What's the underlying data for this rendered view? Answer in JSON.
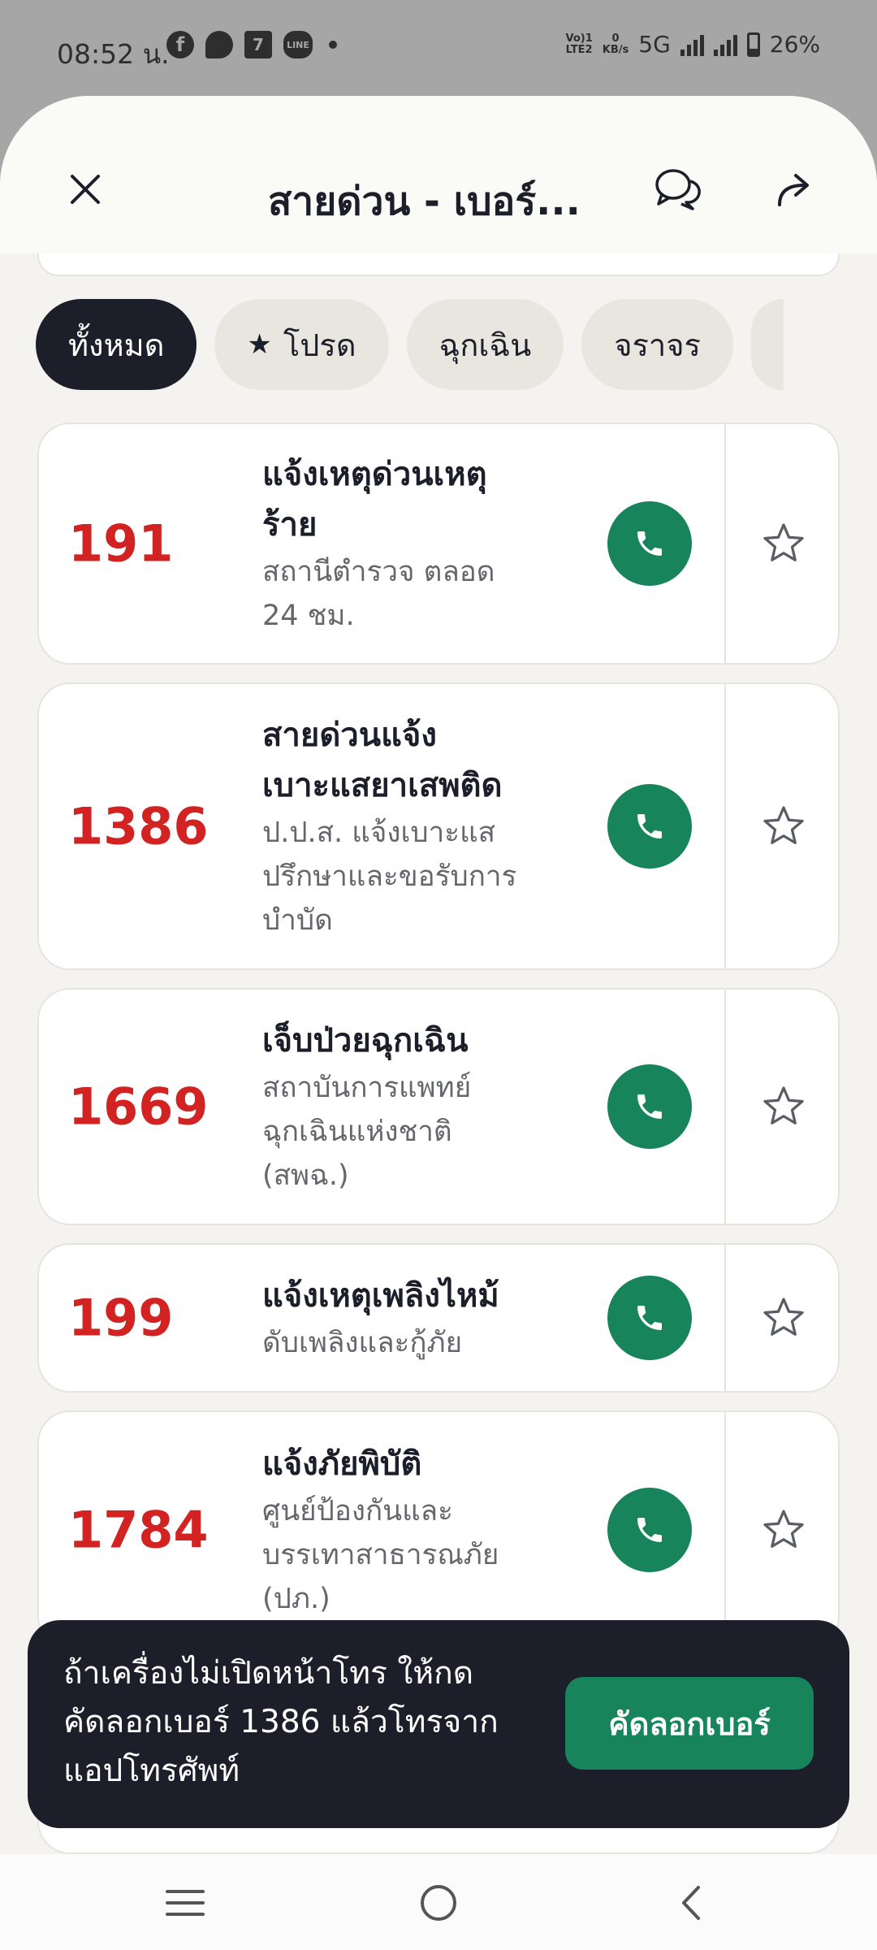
{
  "status_bar": {
    "time": "08:52 น.",
    "icons": [
      "facebook-icon",
      "messenger-icon",
      "seven-eleven-icon",
      "line-icon"
    ],
    "network_top": "Vo)1",
    "network_bottom": "LTE2",
    "speed_value": "0",
    "speed_unit": "KB/s",
    "network_type": "5G",
    "battery": "26%"
  },
  "header": {
    "title": "สายด่วน - เบอร์...",
    "close_icon": "close-icon",
    "chat_icon": "chat-icon",
    "share_icon": "share-icon"
  },
  "filters": [
    {
      "label": "ทั้งหมด",
      "active": true
    },
    {
      "label": "โปรด",
      "icon": "star-icon"
    },
    {
      "label": "ฉุกเฉิน"
    },
    {
      "label": "จราจร"
    }
  ],
  "hotlines": [
    {
      "number": "191",
      "title": [
        "แจ้งเหตุด่วนเหตุ",
        "ร้าย"
      ],
      "desc": [
        "สถานีตำรวจ ตลอด",
        "24 ชม."
      ]
    },
    {
      "number": "1386",
      "title": [
        "สายด่วนแจ้ง",
        "เบาะแสยาเสพติด"
      ],
      "desc": [
        "ป.ป.ส. แจ้งเบาะแส",
        "ปรึกษาและขอรับการ",
        "บำบัด"
      ]
    },
    {
      "number": "1669",
      "title": [
        "เจ็บป่วยฉุกเฉิน"
      ],
      "desc": [
        "สถาบันการแพทย์",
        "ฉุกเฉินแห่งชาติ",
        "(สพฉ.)"
      ]
    },
    {
      "number": "199",
      "title": [
        "แจ้งเหตุเพลิงไหม้"
      ],
      "desc": [
        "ดับเพลิงและกู้ภัย"
      ]
    },
    {
      "number": "1784",
      "title": [
        "แจ้งภัยพิบัติ"
      ],
      "desc": [
        "ศูนย์ป้องกันและ",
        "บรรเทาสาธารณภัย",
        "(ปภ.)"
      ]
    }
  ],
  "toast": {
    "lines": [
      "ถ้าเครื่องไม่เปิดหน้าโทร ให้กด",
      "คัดลอกเบอร์ 1386 แล้วโทรจาก",
      "แอปโทรศัพท์"
    ],
    "button": "คัดลอกเบอร์"
  },
  "colors": {
    "number_red": "#d32222",
    "call_green": "#17845c",
    "dark": "#1c1f2a",
    "chip_bg": "#e8e6df"
  }
}
